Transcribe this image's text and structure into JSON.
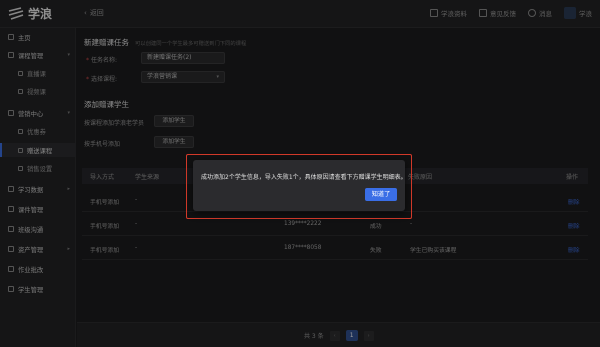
{
  "app": {
    "logo_text": "学浪"
  },
  "topbar": {
    "back_label": "返回",
    "actions": [
      {
        "label": "学浪资料",
        "icon": "document-icon"
      },
      {
        "label": "意见反馈",
        "icon": "feedback-icon"
      },
      {
        "label": "消息",
        "icon": "bell-icon"
      }
    ],
    "user_name": "学浪"
  },
  "sidebar": {
    "items": [
      {
        "label": "主页",
        "icon": "home-icon"
      },
      {
        "label": "课程管理",
        "icon": "course-icon",
        "caret": "▾"
      },
      {
        "label": "直播课",
        "icon": "live-icon",
        "sub": true
      },
      {
        "label": "视频课",
        "icon": "video-icon",
        "sub": true
      },
      {
        "label": "营销中心",
        "icon": "marketing-icon",
        "caret": "▾"
      },
      {
        "label": "优惠券",
        "icon": "coupon-icon",
        "sub": true
      },
      {
        "label": "赠送课程",
        "icon": "gift-icon",
        "sub": true,
        "active": true
      },
      {
        "label": "销售设置",
        "icon": "sales-icon",
        "sub": true
      },
      {
        "label": "学习数据",
        "icon": "chart-icon",
        "caret": "▸"
      },
      {
        "label": "课件管理",
        "icon": "courseware-icon"
      },
      {
        "label": "班级沟通",
        "icon": "chat-icon"
      },
      {
        "label": "资产管理",
        "icon": "asset-icon",
        "caret": "▸"
      },
      {
        "label": "作业批改",
        "icon": "homework-icon"
      },
      {
        "label": "学生管理",
        "icon": "student-icon"
      }
    ]
  },
  "form": {
    "title": "新建赠课任务",
    "hint": "可以创建同一个学生最多可赠送到门下同的课程",
    "name_label": "任务名称:",
    "name_value": "新建赠课任务(2)",
    "course_label": "选择课程:",
    "course_value": "学浪营销课"
  },
  "add_students": {
    "title": "添加赠课学生",
    "by_id_label": "按课程添加学浪老学员",
    "by_id_button": "添加学生",
    "by_phone_label": "按手机号添加",
    "by_phone_button": "添加学生"
  },
  "table": {
    "headers": [
      "导入方式",
      "学生来源",
      "",
      "失败原因",
      "操作"
    ],
    "rows": [
      {
        "method": "手机号添加",
        "source": "-",
        "phone": "",
        "status": "",
        "reason": "",
        "action": "删除"
      },
      {
        "method": "手机号添加",
        "source": "-",
        "phone": "139****2222",
        "status": "成功",
        "reason": "-",
        "action": "删除"
      },
      {
        "method": "手机号添加",
        "source": "-",
        "phone": "187****8058",
        "status": "失败",
        "reason": "学生已购买该课程",
        "action": "删除"
      }
    ]
  },
  "footer": {
    "total": "共 3 条",
    "current_page": "1",
    "prev": "‹",
    "next": "›"
  },
  "modal": {
    "message": "成功添加2个学生信息，导入失败1个，具体原因请查看下方赠课学生明细表。",
    "button": "知道了"
  },
  "colors": {
    "accent": "#3a6ee6",
    "highlight_outline": "#d43a2a",
    "background": "#1c1c1e"
  }
}
